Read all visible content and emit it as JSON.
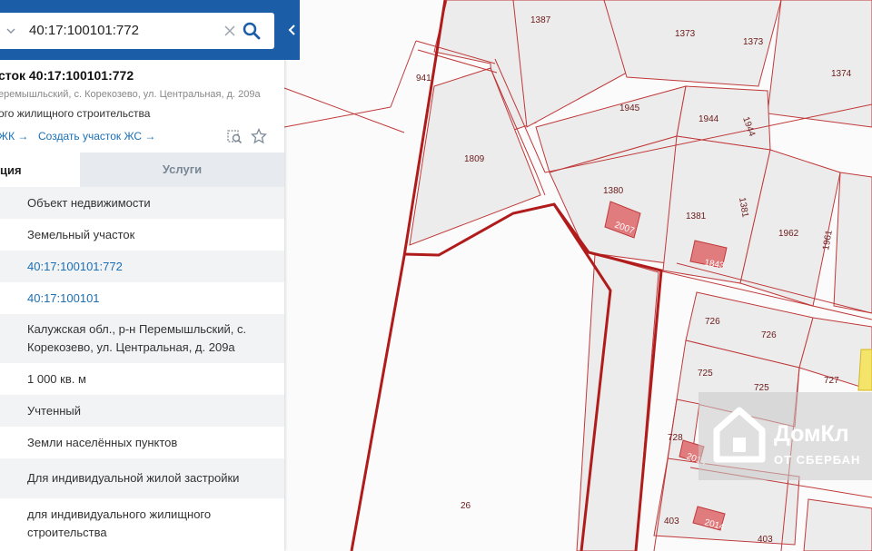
{
  "search": {
    "query": "40:17:100101:772"
  },
  "card": {
    "title": "сток 40:17:100101:772",
    "address_line": "еремышльский, с. Корекозево, ул. Центральная, д. 209а",
    "purpose": "ого жилищного строительства",
    "link_left": "ЖК →",
    "link_create": "Создать участок ЖС →"
  },
  "tabs": {
    "info": "ция",
    "services": "Услуги"
  },
  "rows": [
    "Объект недвижимости",
    "Земельный участок",
    "40:17:100101:772",
    "40:17:100101",
    "Калужская обл., р-н Перемышльский, с. Корекозево, ул. Центральная, д. 209а",
    "1 000 кв. м",
    "Учтенный",
    "Земли населённых пунктов",
    "Для индивидуальной жилой застройки",
    "для индивидуального жилищного строительства"
  ],
  "map": {
    "parcel_labels": [
      "1387",
      "1373",
      "1373",
      "1374",
      "941",
      "1945",
      "1944",
      "1944",
      "1809",
      "1380",
      "2007",
      "1381",
      "1381",
      "1962",
      "1961",
      "1843",
      "726",
      "726",
      "725",
      "725",
      "727",
      "728",
      "2014",
      "403",
      "2014",
      "403",
      "26"
    ]
  },
  "logo": {
    "name": "ДомКл",
    "sub": "ОТ СБЕРБАН"
  },
  "colors": {
    "brand": "#1b5ea7",
    "link": "#1a6fb5",
    "parcel_line": "#b01c1c"
  }
}
